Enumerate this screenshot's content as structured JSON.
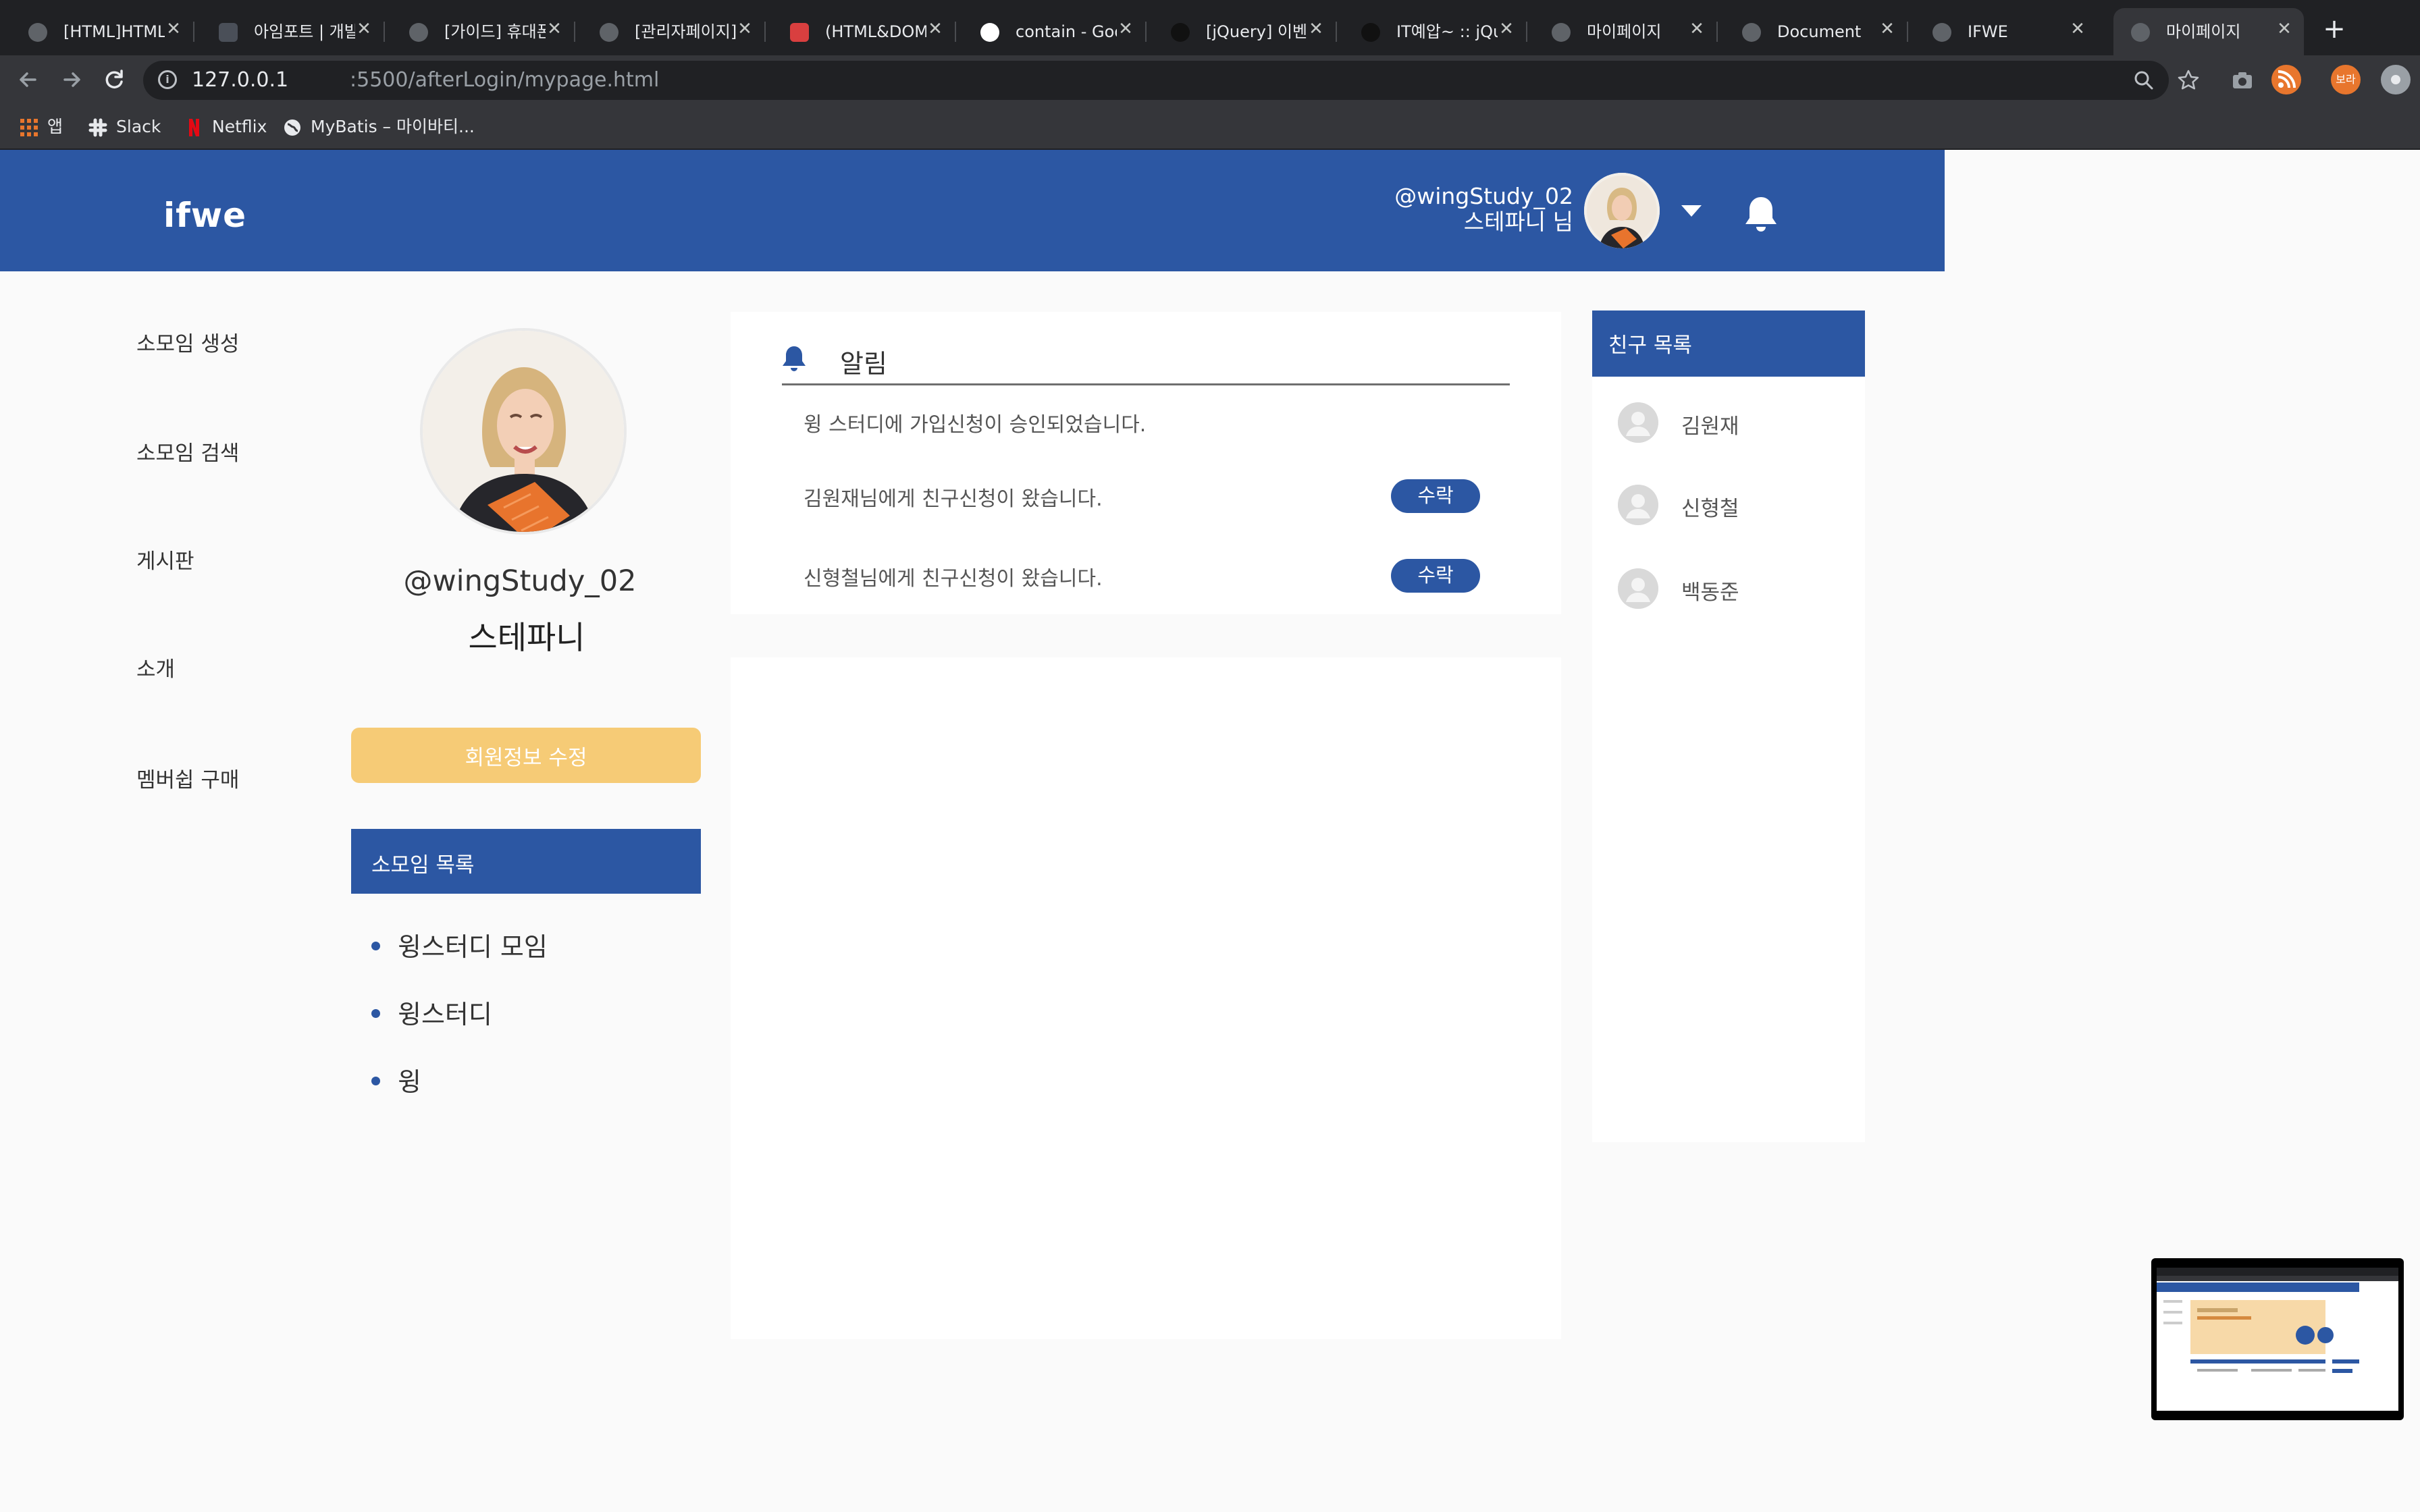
{
  "browser": {
    "tabs": [
      {
        "title": "[HTML]HTML에"
      },
      {
        "title": "아임포트 | 개발자"
      },
      {
        "title": "[가이드] 휴대폰"
      },
      {
        "title": "[관리자페이지] 회"
      },
      {
        "title": "(HTML&DOM) 요"
      },
      {
        "title": "contain - Goog"
      },
      {
        "title": "[jQuery] 이벤트"
      },
      {
        "title": "IT예압~ :: jQue"
      },
      {
        "title": "마이페이지"
      },
      {
        "title": "Document"
      },
      {
        "title": "IFWE"
      },
      {
        "title": "마이페이지"
      }
    ],
    "tab_close": "✕",
    "new_tab": "+",
    "url_host": "127.0.0.1",
    "url_path": ":5500/afterLogin/mypage.html",
    "profile_badge": "보라",
    "bookmarks": [
      {
        "label": "앱"
      },
      {
        "label": "Slack"
      },
      {
        "label": "Netflix"
      },
      {
        "label": "MyBatis – 마이바티..."
      }
    ],
    "colors": {
      "frame": "#202124",
      "toolbar": "#35363a",
      "accent_orange": "#e8762d"
    }
  },
  "header": {
    "logo": "ifwe",
    "user_handle": "@wingStudy_02",
    "user_nickname": "스테파니 님",
    "color": "#2c57a3"
  },
  "left_nav": {
    "items": [
      {
        "label": "소모임 생성"
      },
      {
        "label": "소모임 검색"
      },
      {
        "label": "게시판"
      },
      {
        "label": "소개"
      },
      {
        "label": "멤버쉽 구매"
      }
    ]
  },
  "profile": {
    "handle": "@wingStudy_02",
    "name": "스테파니",
    "edit_button": "회원정보 수정",
    "edit_color": "#f6cb76"
  },
  "groups": {
    "title": "소모임 목록",
    "items": [
      {
        "label": "윙스터디 모임"
      },
      {
        "label": "윙스터디"
      },
      {
        "label": "윙"
      }
    ]
  },
  "notifications": {
    "title": "알림",
    "items": [
      {
        "text": "윙 스터디에 가입신청이 승인되었습니다.",
        "action": ""
      },
      {
        "text": "김원재님에게 친구신청이 왔습니다.",
        "action": "수락"
      },
      {
        "text": "신형철님에게 친구신청이 왔습니다.",
        "action": "수락"
      }
    ]
  },
  "friends": {
    "title": "친구 목록",
    "items": [
      {
        "name": "김원재"
      },
      {
        "name": "신형철"
      },
      {
        "name": "백동준"
      }
    ]
  }
}
